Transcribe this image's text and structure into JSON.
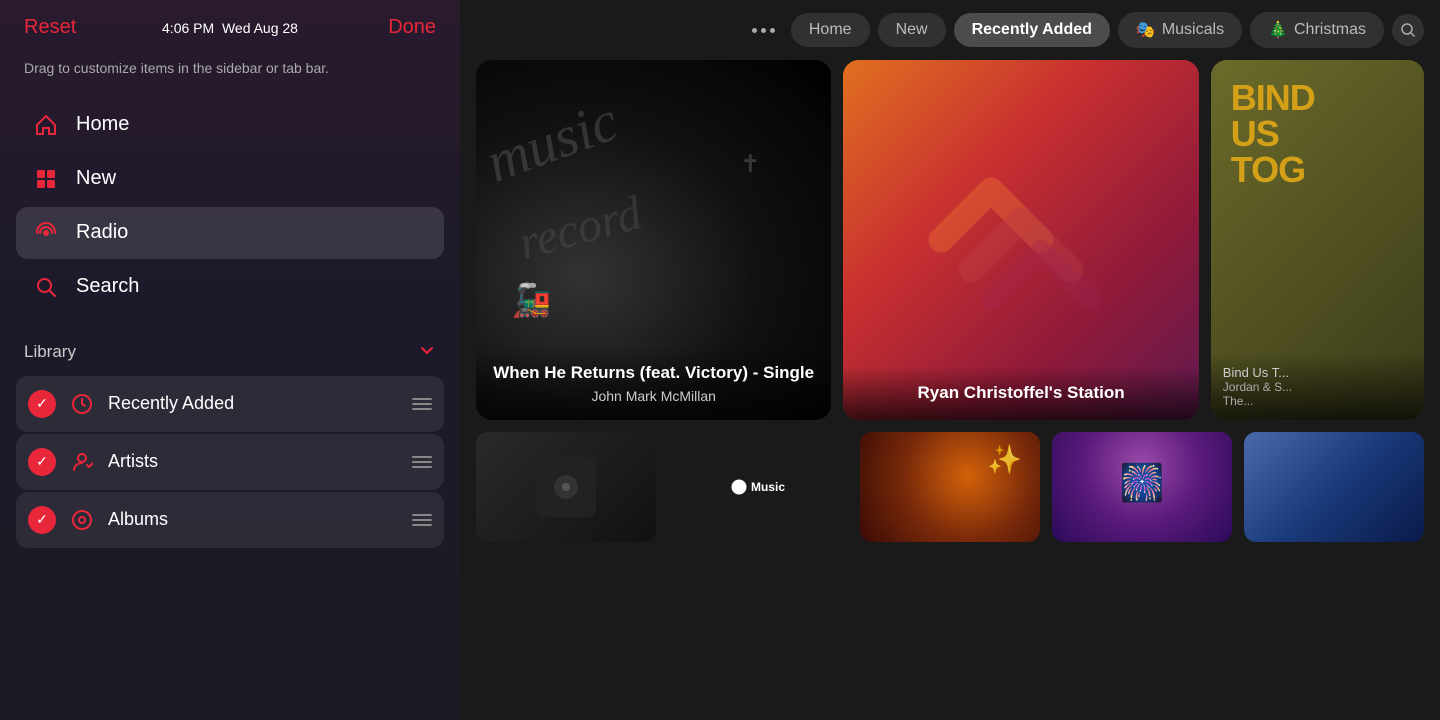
{
  "sidebar": {
    "time": "4:06 PM",
    "date": "Wed Aug 28",
    "reset_label": "Reset",
    "done_label": "Done",
    "hint": "Drag to customize items in the sidebar or tab bar.",
    "nav_items": [
      {
        "id": "home",
        "label": "Home",
        "icon": "🏠",
        "active": false
      },
      {
        "id": "new",
        "label": "New",
        "icon": "⊞",
        "active": false
      },
      {
        "id": "radio",
        "label": "Radio",
        "icon": "📡",
        "active": true
      },
      {
        "id": "search",
        "label": "Search",
        "icon": "🔍",
        "active": false
      }
    ],
    "library_title": "Library",
    "library_items": [
      {
        "id": "recently-added",
        "label": "Recently Added",
        "icon": "🕐",
        "checked": true
      },
      {
        "id": "artists",
        "label": "Artists",
        "icon": "🎤",
        "checked": true
      },
      {
        "id": "albums",
        "label": "Albums",
        "icon": "💿",
        "checked": true
      }
    ]
  },
  "tabs": {
    "more_label": "•••",
    "items": [
      {
        "id": "home",
        "label": "Home",
        "active": false
      },
      {
        "id": "new",
        "label": "New",
        "active": false
      },
      {
        "id": "recently-added",
        "label": "Recently Added",
        "active": true
      },
      {
        "id": "musicals",
        "label": "🎭 Musicals",
        "active": false,
        "emoji": "🎭"
      },
      {
        "id": "christmas",
        "label": "🎄 Christmas",
        "active": false,
        "emoji": "🎄"
      }
    ]
  },
  "cards": {
    "row1": [
      {
        "id": "card-when-he-returns",
        "title": "When He Returns (feat. Victory) - Single",
        "subtitle": "John Mark McMillan"
      },
      {
        "id": "card-ryan-christoffel",
        "title": "Ryan Christoffel's Station",
        "subtitle": ""
      },
      {
        "id": "card-bind-us",
        "title": "BIND US TOG...",
        "subtitle": "Bind Us T...\nJordan & S...\nThe..."
      }
    ]
  },
  "icons": {
    "home": "house",
    "new": "grid",
    "radio": "radio-waves",
    "search": "magnifyingglass",
    "chevron-down": "chevron.down",
    "drag-handle": "line.3.horizontal"
  }
}
